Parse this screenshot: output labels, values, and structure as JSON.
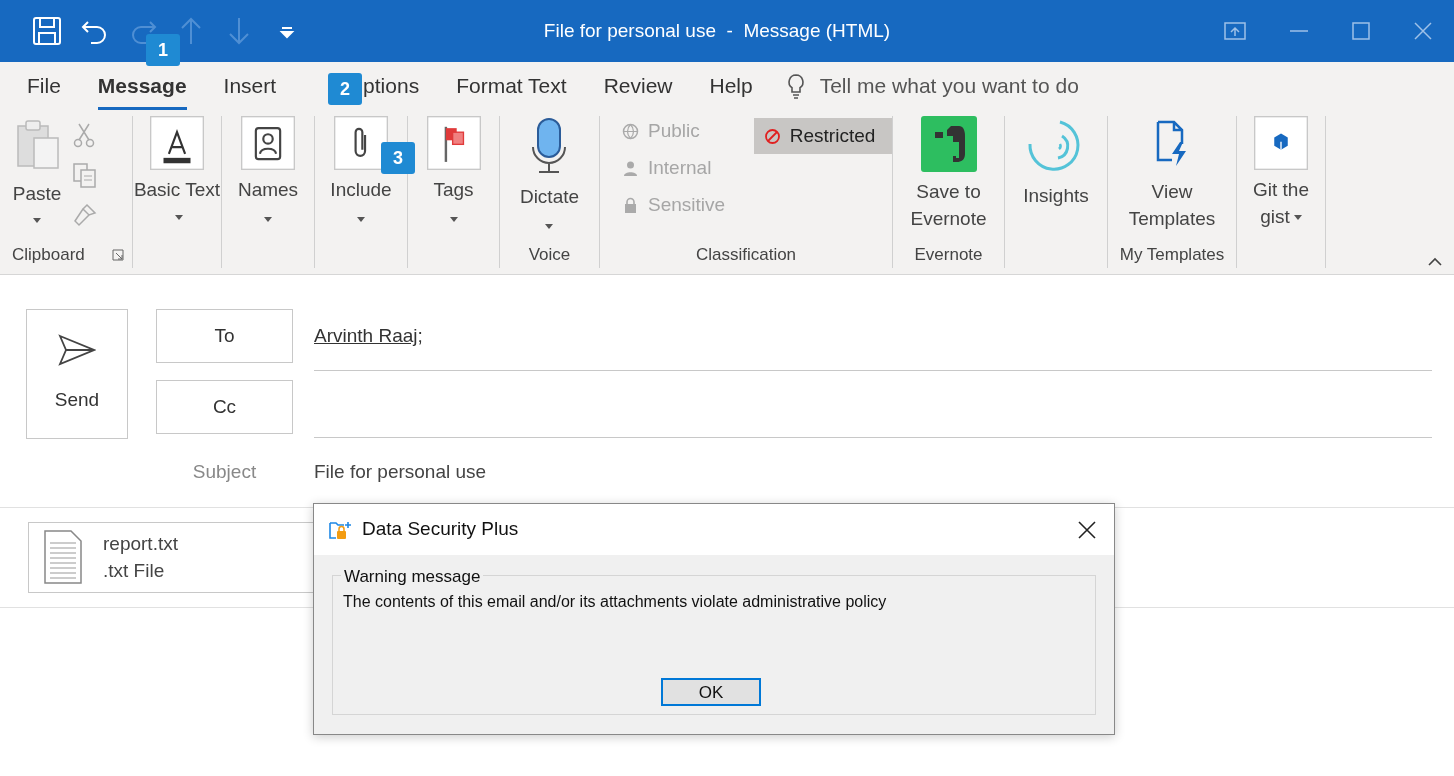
{
  "window": {
    "title": "File for personal use  -  Message (HTML)"
  },
  "quick_access": [
    {
      "kind": "save",
      "disabled": false
    },
    {
      "kind": "undo",
      "disabled": false
    },
    {
      "kind": "redo",
      "disabled": true
    },
    {
      "kind": "up",
      "disabled": true
    },
    {
      "kind": "down",
      "disabled": true
    },
    {
      "kind": "customize",
      "disabled": false
    }
  ],
  "tabs": [
    {
      "label": "File",
      "selected": false
    },
    {
      "label": "Message",
      "selected": true
    },
    {
      "label": "Insert",
      "selected": false
    },
    {
      "label": "ptions",
      "selected": false
    },
    {
      "label": "Format Text",
      "selected": false
    },
    {
      "label": "Review",
      "selected": false
    },
    {
      "label": "Help",
      "selected": false
    }
  ],
  "tell_me": {
    "placeholder": "Tell me what you want to do"
  },
  "ribbon": {
    "groups": [
      {
        "label": "Clipboard",
        "launcher": true,
        "buttons": [
          {
            "kind": "paste",
            "label": "Paste",
            "dropdown": true
          }
        ]
      },
      {
        "buttons": [
          {
            "kind": "basic-text",
            "label": "Basic Text",
            "dropdown": true
          }
        ]
      },
      {
        "buttons": [
          {
            "kind": "names",
            "label": "Names",
            "dropdown": true
          }
        ]
      },
      {
        "buttons": [
          {
            "kind": "include",
            "label": "Include",
            "dropdown": true
          }
        ]
      },
      {
        "buttons": [
          {
            "kind": "tags",
            "label": "Tags",
            "dropdown": true
          }
        ]
      },
      {
        "label": "Voice",
        "buttons": [
          {
            "kind": "dictate",
            "label": "Dictate",
            "dropdown": true
          }
        ]
      },
      {
        "label": "Classification"
      },
      {
        "label": "Evernote",
        "buttons": [
          {
            "kind": "evernote",
            "label": "Save to Evernote",
            "dropdown": false
          }
        ]
      },
      {
        "buttons": [
          {
            "kind": "insights",
            "label": "Insights",
            "dropdown": false
          }
        ]
      },
      {
        "label": "My Templates",
        "buttons": [
          {
            "kind": "templates",
            "label": "View Templates",
            "dropdown": false
          }
        ]
      },
      {
        "buttons": [
          {
            "kind": "gist",
            "label": "Git the gist",
            "dropdown": true
          }
        ]
      }
    ]
  },
  "classification": [
    {
      "kind": "globe",
      "label": "Public",
      "selected": false
    },
    {
      "kind": "person",
      "label": "Internal",
      "selected": false
    },
    {
      "kind": "lock",
      "label": "Sensitive",
      "selected": false
    },
    {
      "kind": "blocked",
      "label": "Restricted",
      "selected": true
    }
  ],
  "callouts": [
    {
      "number": "1"
    },
    {
      "number": "2"
    },
    {
      "number": "3"
    }
  ],
  "compose": {
    "send": "Send",
    "to_button": "To",
    "to_value": "Arvinth Raaj;",
    "cc_button": "Cc",
    "subject_label": "Subject",
    "subject_value": "File for personal use"
  },
  "attachment": {
    "name": "report.txt",
    "type": ".txt File"
  },
  "dialog": {
    "title": "Data Security Plus",
    "group_label": "Warning message",
    "message": "The contents of this email and/or its attachments violate administrative policy",
    "button": "OK"
  }
}
